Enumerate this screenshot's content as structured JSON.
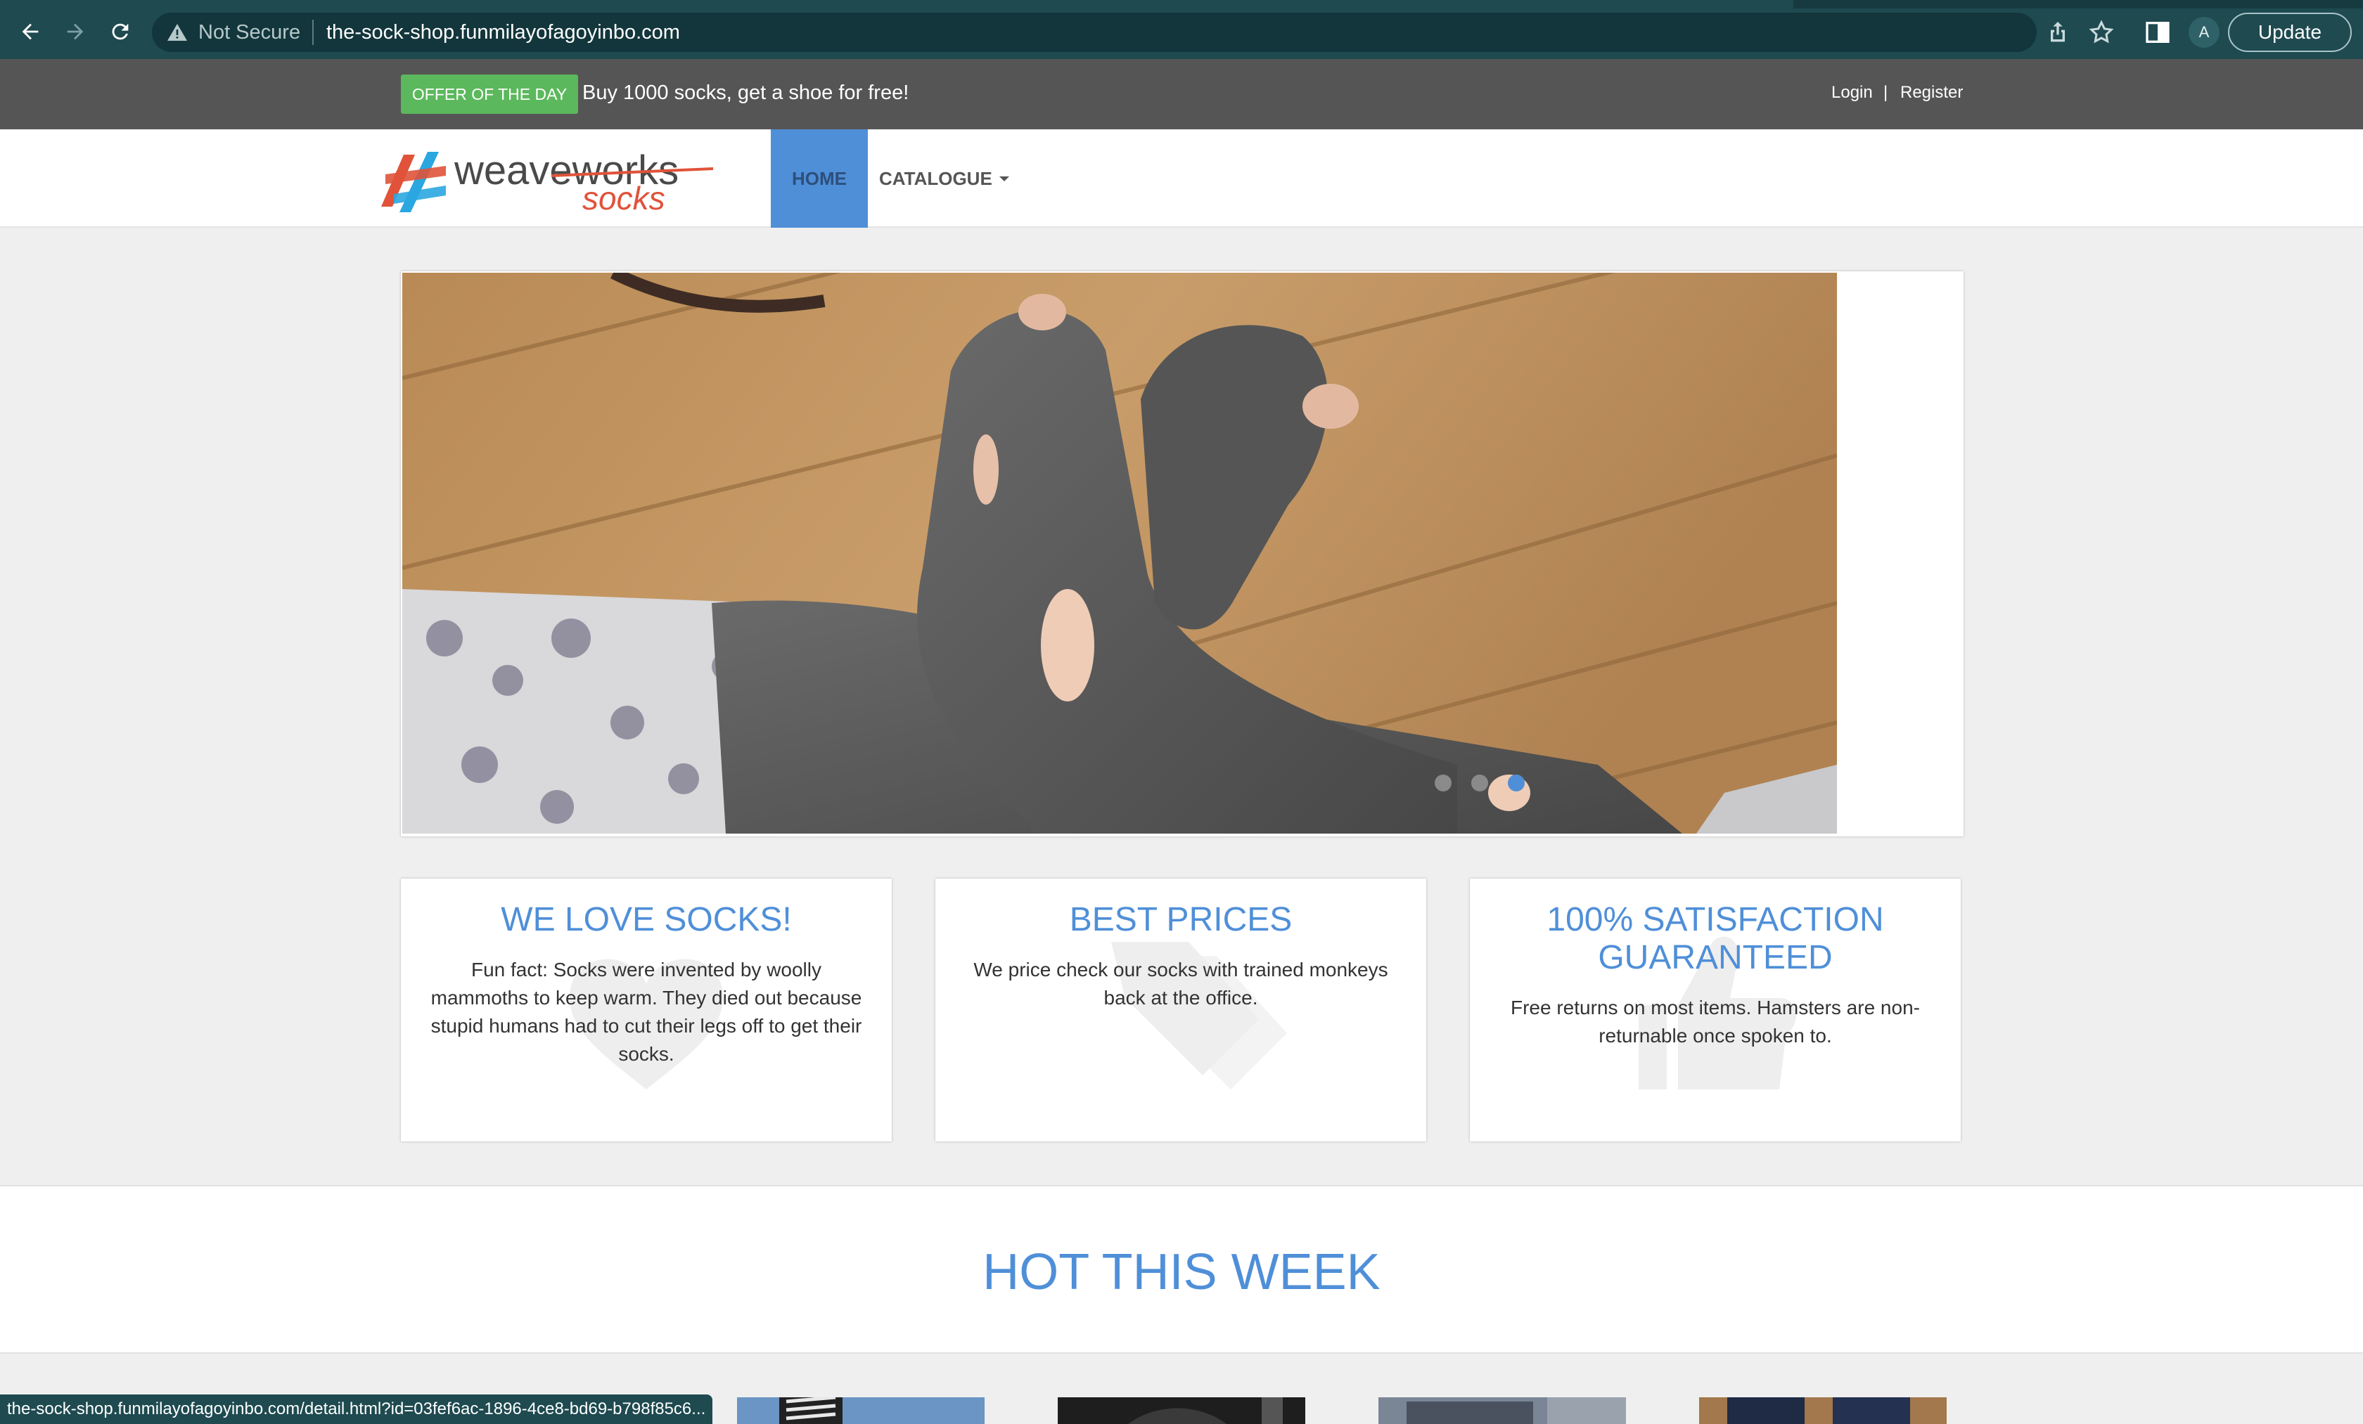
{
  "browser": {
    "security_label": "Not Secure",
    "url": "the-sock-shop.funmilayofagoyinbo.com",
    "profile_initial": "A",
    "update_label": "Update",
    "status_url": "the-sock-shop.funmilayofagoyinbo.com/detail.html?id=03fef6ac-1896-4ce8-bd69-b798f85c6..."
  },
  "topbar": {
    "offer_badge": "OFFER OF THE DAY",
    "offer_text": "Buy 1000 socks, get a shoe for free!",
    "login": "Login",
    "separator": "|",
    "register": "Register"
  },
  "navbar": {
    "logo_word": "weaveworks",
    "logo_sub": "socks",
    "home": "HOME",
    "catalogue": "CATALOGUE"
  },
  "carousel": {
    "slide_count": 3,
    "active_index": 2
  },
  "features": [
    {
      "title": "WE LOVE SOCKS!",
      "text": "Fun fact: Socks were invented by woolly mammoths to keep warm. They died out because stupid humans had to cut their legs off to get their socks.",
      "icon": "heart-icon"
    },
    {
      "title": "BEST PRICES",
      "text": "We price check our socks with trained monkeys back at the office.",
      "icon": "tag-icon"
    },
    {
      "title": "100% SATISFACTION GUARANTEED",
      "text": "Free returns on most items. Hamsters are non-returnable once spoken to.",
      "icon": "thumbs-up-icon"
    }
  ],
  "hot": {
    "title": "HOT THIS WEEK"
  },
  "colors": {
    "accent": "#4f8fd8",
    "offer_green": "#5cb85c",
    "topbar": "#555555",
    "chrome": "#1e4a50"
  }
}
